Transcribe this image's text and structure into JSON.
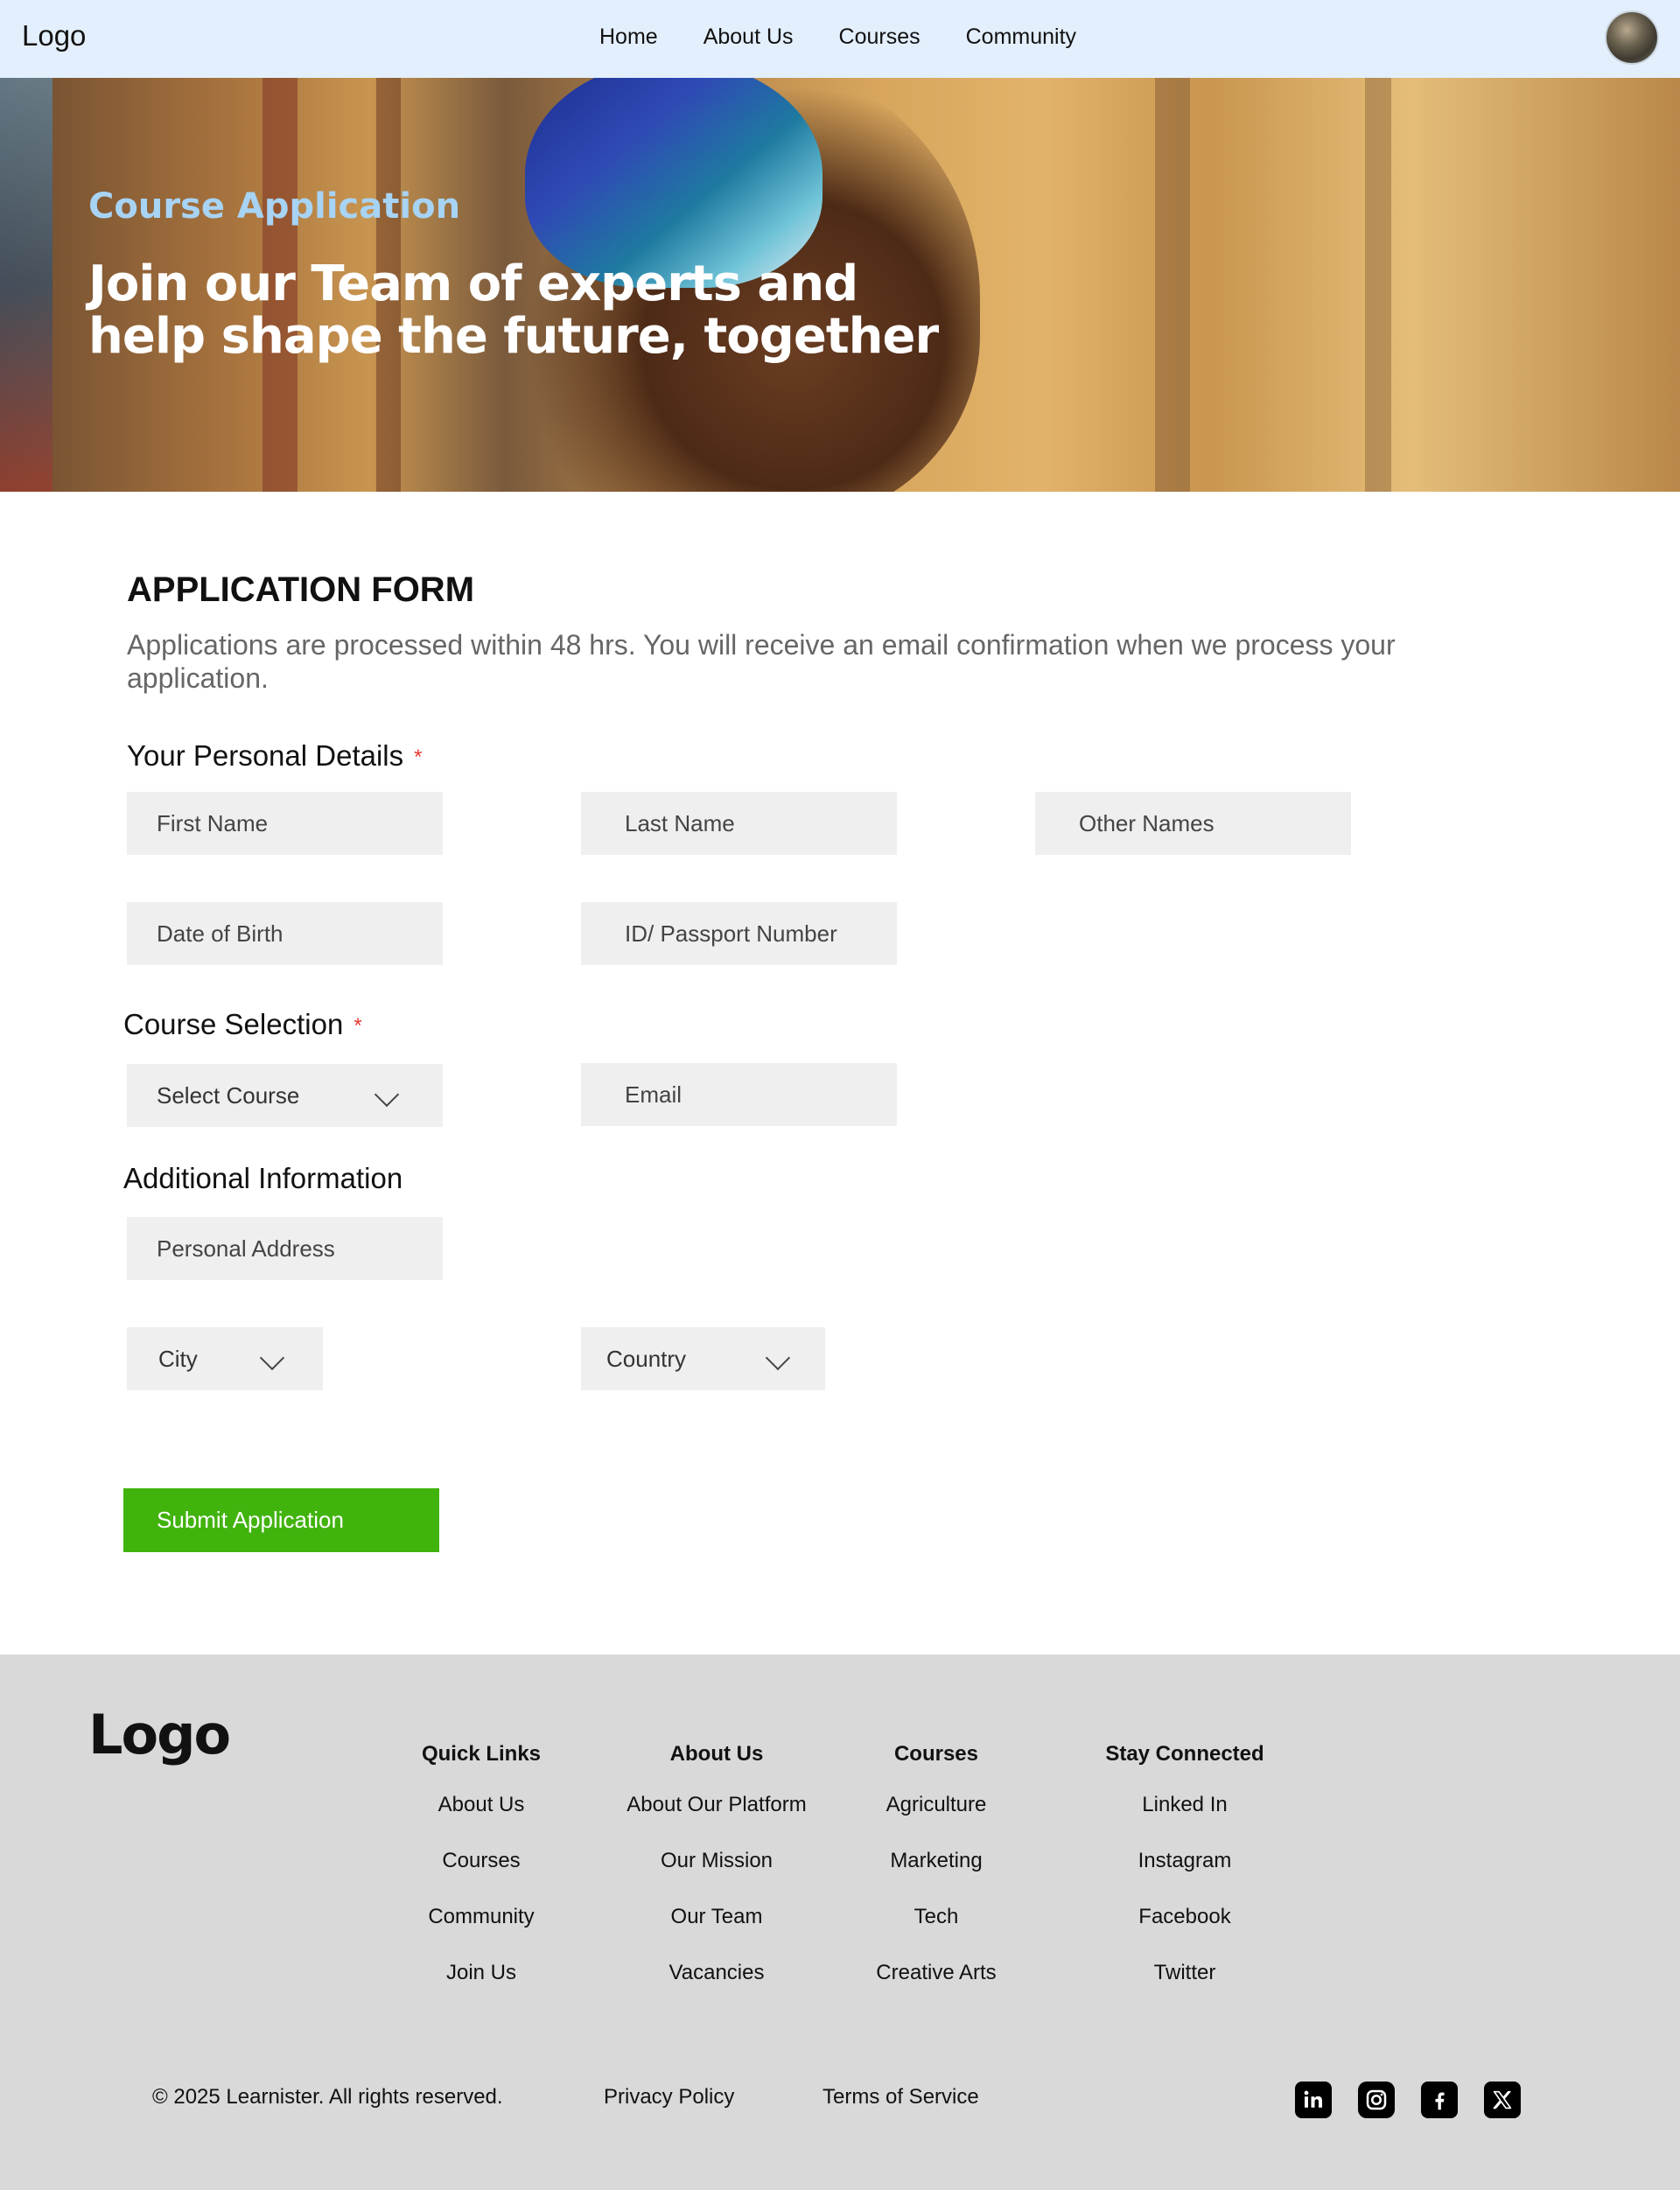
{
  "nav": {
    "logo": "Logo",
    "links": [
      "Home",
      "About Us",
      "Courses",
      "Community"
    ]
  },
  "hero": {
    "subtitle": "Course Application",
    "title": "Join our Team of experts and help shape the future, together"
  },
  "form": {
    "title": "APPLICATION FORM",
    "description": "Applications are processed within 48 hrs. You will receive an email confirmation when we process your application.",
    "personal_label": "Your Personal Details",
    "required_mark": "*",
    "first_name": "First Name",
    "last_name": "Last Name",
    "other_names": "Other Names",
    "dob": "Date of Birth",
    "id_number": "ID/ Passport Number",
    "course_label": "Course Selection",
    "select_course": "Select Course",
    "email": "Email",
    "additional_label": "Additional Information",
    "address": "Personal Address",
    "city": "City",
    "country": "Country",
    "submit": "Submit Application"
  },
  "footer": {
    "logo": "Logo",
    "columns": [
      {
        "title": "Quick Links",
        "items": [
          "About Us",
          "Courses",
          "Community",
          "Join Us"
        ]
      },
      {
        "title": "About Us",
        "items": [
          "About Our Platform",
          "Our Mission",
          "Our Team",
          "Vacancies"
        ]
      },
      {
        "title": "Courses",
        "items": [
          "Agriculture",
          "Marketing",
          "Tech",
          "Creative Arts"
        ]
      },
      {
        "title": "Stay Connected",
        "items": [
          "Linked In",
          "Instagram",
          "Facebook",
          "Twitter"
        ]
      }
    ],
    "copyright": "© 2025 Learnister. All rights reserved.",
    "privacy": "Privacy Policy",
    "terms": "Terms of Service",
    "social_icons": [
      "linkedin-icon",
      "instagram-icon",
      "facebook-icon",
      "x-icon"
    ]
  },
  "colors": {
    "nav_bg": "#e3effc",
    "hero_subtitle": "#a7d3f4",
    "submit_bg": "#41b30d",
    "field_bg": "#efefef",
    "footer_bg": "#d9d9d9",
    "required": "#e53935"
  }
}
